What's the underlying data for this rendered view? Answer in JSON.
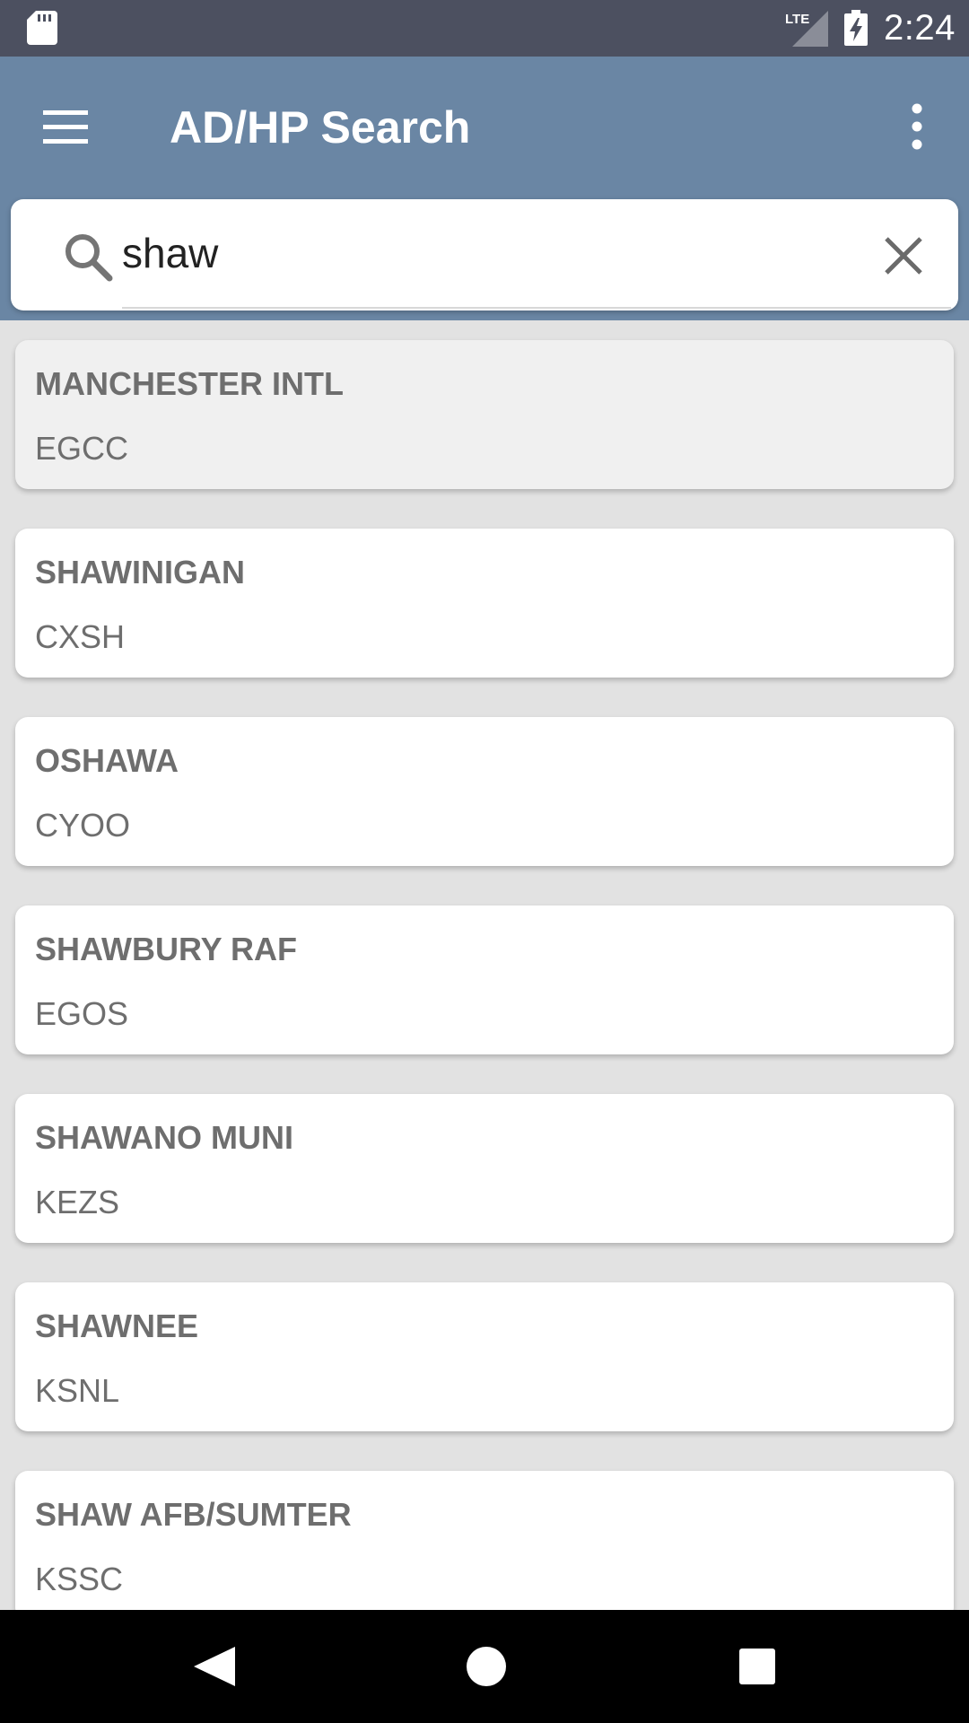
{
  "status_bar": {
    "time": "2:24",
    "network": "LTE",
    "icons": [
      "sd-card-icon",
      "lte-signal-icon",
      "battery-charging-icon"
    ]
  },
  "app_bar": {
    "title": "AD/HP Search",
    "icons": [
      "menu-icon",
      "more-vert-icon"
    ],
    "color": "#6a86a4"
  },
  "search": {
    "value": "shaw",
    "icons": [
      "search-icon",
      "clear-icon"
    ]
  },
  "results": [
    {
      "name": "MANCHESTER INTL",
      "code": "EGCC",
      "selected": true
    },
    {
      "name": "SHAWINIGAN",
      "code": "CXSH"
    },
    {
      "name": "OSHAWA",
      "code": "CYOO"
    },
    {
      "name": "SHAWBURY RAF",
      "code": "EGOS"
    },
    {
      "name": "SHAWANO MUNI",
      "code": "KEZS"
    },
    {
      "name": "SHAWNEE",
      "code": "KSNL"
    },
    {
      "name": "SHAW AFB/SUMTER",
      "code": "KSSC"
    }
  ],
  "nav_bar": {
    "icons": [
      "back-icon",
      "home-icon",
      "recents-icon"
    ]
  }
}
